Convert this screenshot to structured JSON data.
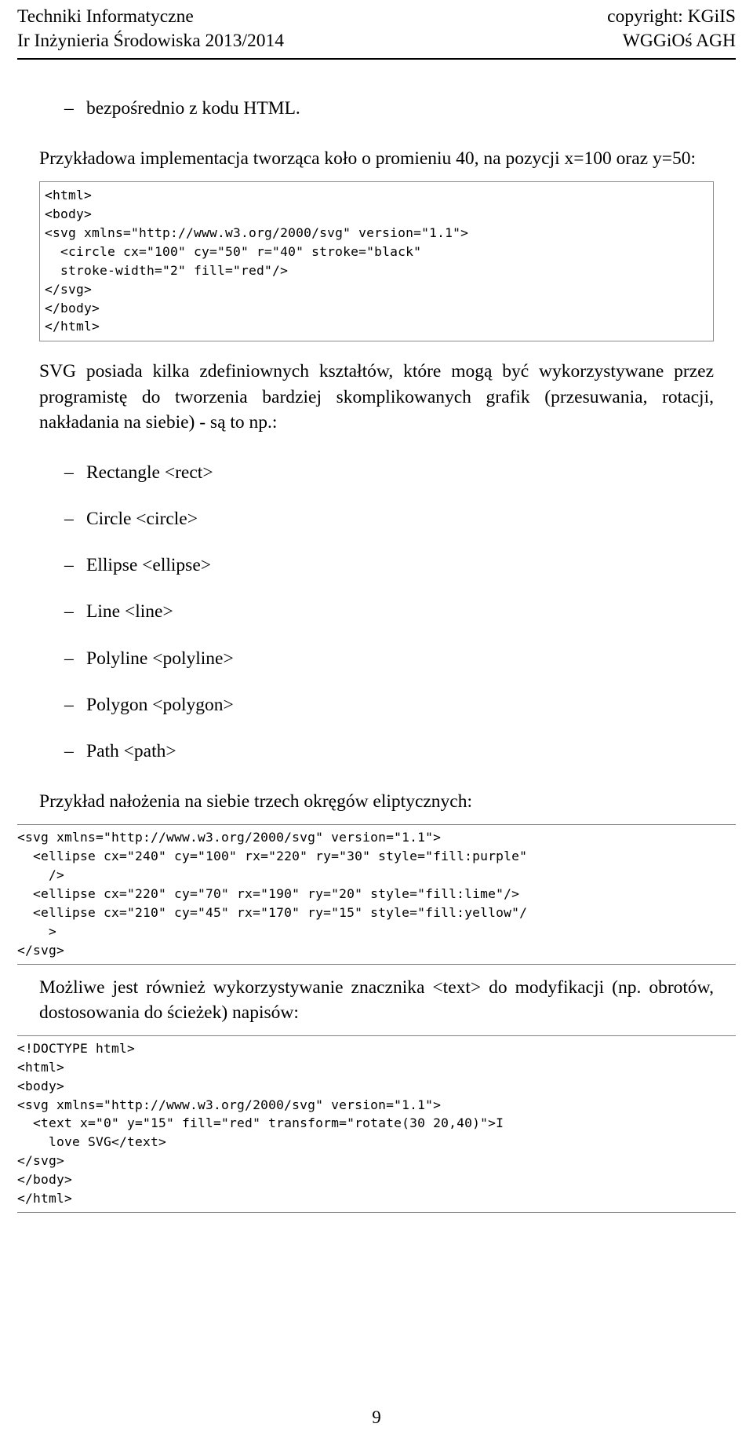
{
  "header": {
    "left_line1": "Techniki Informatyczne",
    "left_line2": "Ir Inżynieria Środowiska 2013/2014",
    "right_line1": "copyright: KGiIS",
    "right_line2": "WGGiOś AGH"
  },
  "content": {
    "bullet_html_source": {
      "dash": "–",
      "text": "bezpośrednio z kodu HTML."
    },
    "para_example_intro": "Przykładowa implementacja tworząca koło o promieniu 40, na pozycji x=100 oraz y=50:",
    "para_shapes": "SVG posiada kilka zdefiniownych kształtów, które mogą być wykorzystywane przez programistę do tworzenia bardziej skomplikowanych grafik (przesuwania, rotacji, nakładania na siebie) - są to np.:",
    "para_ellipses_intro": "Przykład nałożenia na siebie trzech okręgów eliptycznych:",
    "para_text_tag": "Możliwe jest również wykorzystywanie znacznika <text> do modyfikacji (np. obrotów, dostosowania do ścieżek) napisów:"
  },
  "shape_list": [
    {
      "dash": "–",
      "name": "Rectangle",
      "tag": "<rect>"
    },
    {
      "dash": "–",
      "name": "Circle",
      "tag": "<circle>"
    },
    {
      "dash": "–",
      "name": "Ellipse",
      "tag": "<ellipse>"
    },
    {
      "dash": "–",
      "name": "Line",
      "tag": "<line>"
    },
    {
      "dash": "–",
      "name": "Polyline",
      "tag": "<polyline>"
    },
    {
      "dash": "–",
      "name": "Polygon",
      "tag": "<polygon>"
    },
    {
      "dash": "–",
      "name": "Path",
      "tag": "<path>"
    }
  ],
  "code_blocks": {
    "circle_example": [
      "<html>",
      "<body>",
      "<svg xmlns=\"http://www.w3.org/2000/svg\" version=\"1.1\">",
      "  <circle cx=\"100\" cy=\"50\" r=\"40\" stroke=\"black\"",
      "  stroke-width=\"2\" fill=\"red\"/>",
      "</svg>",
      "</body>",
      "</html>"
    ],
    "ellipses_example": [
      "<svg xmlns=\"http://www.w3.org/2000/svg\" version=\"1.1\">",
      "  <ellipse cx=\"240\" cy=\"100\" rx=\"220\" ry=\"30\" style=\"fill:purple\"",
      "    />",
      "  <ellipse cx=\"220\" cy=\"70\" rx=\"190\" ry=\"20\" style=\"fill:lime\"/>",
      "  <ellipse cx=\"210\" cy=\"45\" rx=\"170\" ry=\"15\" style=\"fill:yellow\"/",
      "    >",
      "</svg>"
    ],
    "text_example": [
      "<!DOCTYPE html>",
      "<html>",
      "<body>",
      "<svg xmlns=\"http://www.w3.org/2000/svg\" version=\"1.1\">",
      "  <text x=\"0\" y=\"15\" fill=\"red\" transform=\"rotate(30 20,40)\">I",
      "    love SVG</text>",
      "</svg>",
      "</body>",
      "</html>"
    ]
  },
  "footer": {
    "page_number": "9"
  }
}
